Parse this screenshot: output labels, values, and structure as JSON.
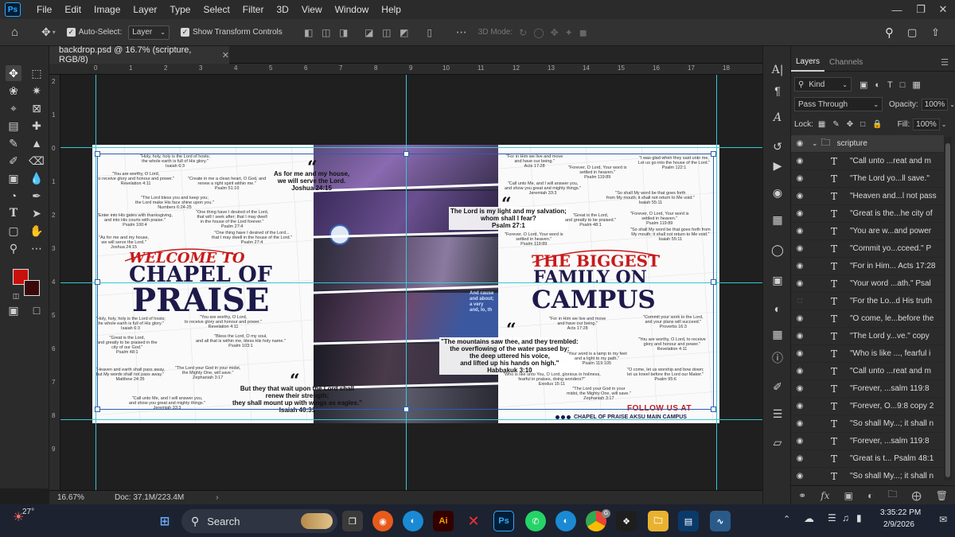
{
  "app": {
    "logo": "Ps",
    "menus": [
      "File",
      "Edit",
      "Image",
      "Layer",
      "Type",
      "Select",
      "Filter",
      "3D",
      "View",
      "Window",
      "Help"
    ]
  },
  "options": {
    "auto_select_label": "Auto-Select:",
    "auto_select_target": "Layer",
    "transform_controls_label": "Show Transform Controls",
    "mode_3d_label": "3D Mode:"
  },
  "document": {
    "tab_title": "backdrop.psd @ 16.7% (scripture, RGB/8)",
    "ruler_top": [
      "0",
      "1",
      "2",
      "3",
      "4",
      "5",
      "6",
      "7",
      "8",
      "9",
      "10",
      "11",
      "12",
      "13",
      "14",
      "15",
      "16",
      "17",
      "18"
    ],
    "ruler_left": [
      "2",
      "1",
      "0",
      "1",
      "2",
      "3",
      "4",
      "5",
      "6",
      "7",
      "8",
      "9"
    ]
  },
  "artwork": {
    "left_title_script": "WELCOME TO",
    "left_title_line1": "CHAPEL OF",
    "left_title_line2": "PRAISE",
    "right_title_line1": "THE BIGGEST",
    "right_title_line2": "FAMILY ON",
    "right_title_line3": "CAMPUS",
    "follow_us": "FOLLOW US AT",
    "handle": "CHAPEL OF PRAISE AKSU MAIN CAMPUS",
    "quote_joshua": "As for me and my house,\nwe will serve the Lord.\nJoshua 24:15",
    "quote_psalm27": "The Lord is my light and my salvation;\nwhom shall I fear?\nPsalm 27:1",
    "quote_habakkuk": "\"The mountains saw thee, and they trembled:\nthe overflowing of the water passed by:\nthe deep uttered his voice,\nand lifted up his hands on high.\"\nHabbakuk 3:10",
    "quote_isaiah": "But they that wait upon the Lord shall\nrenew their strength;\nthey shall mount up with wings as eagles.\"\nIsaiah 40:31",
    "small_verses_left": [
      "\"Holy, holy, holy is the Lord of hosts;\nthe whole earth is full of His glory.\"\nIsaiah 6:3",
      "\"You are worthy, O Lord,\nto receive glory and honour and power.\"\nRevelation 4:11",
      "\"Create in me a clean heart, O God, and\nrenew a right spirit within me.\"\nPsalm 51:10",
      "\"The Lord bless you and keep you;\nthe Lord make His face shine upon you.\"\nNumbers 6:24-25",
      "\"Enter into His gates with thanksgiving,\nand into His courts with praise.\"\nPsalm 100:4",
      "\"One thing have I desired of the Lord,\nthat will I seek after; that I may dwell\nin the house of the Lord forever.\"\nPsalm 27:4",
      "\"As for me and my house,\nwe will serve the Lord.\"\nJoshua 24:15",
      "\"One thing have I desired of the Lord...\nthat I may dwell in the house of the Lord.\"\nPsalm 27:4",
      "\"Holy, holy, holy is the Lord of hosts;\nthe whole earth is full of His glory.\"\nIsaiah 6:3",
      "\"You are worthy, O Lord,\nto receive glory and honour and power.\"\nRevelation 4:11",
      "\"Great is the Lord,\nand greatly to be praised in the\ncity of our God.\"\nPsalm 48:1",
      "\"Bless the Lord, O my soul,\nand all that is within me, bless His holy name.\"\nPsalm 103:1",
      "\"Heaven and earth shall pass away,\nbut My words shall not pass away.\"\nMatthew 24:35",
      "\"The Lord your God in your midst,\nthe Mighty One, will save.\"\nZephaniah 3:17",
      "\"Call unto Me, and I will answer you,\nand show you great and mighty things.\"\nJeremiah 33:3"
    ],
    "small_verses_right": [
      "\"For in Him we live and move\nand have our being.\"\nActs 17:28",
      "\"Forever, O Lord, Your word is\nsettled in heaven.\"\nPsalm 119:89",
      "\"I was glad when they said unto me,\nLet us go into the house of the Lord.\"\nPsalm 122:1",
      "\"Call unto Me, and I will answer you,\nand show you great and mighty things.\"\nJeremiah 33:3",
      "\"So shall My word be that goes forth\nfrom My mouth; it shall not return to Me void.\"\nIsaiah 55:11",
      "\"Great is the Lord,\nand greatly to be praised.\"\nPsalm 48:1",
      "\"Forever, O Lord, Your word is\nsettled in heaven.\"\nPsalm 119:89",
      "\"Forever, O Lord, Your word is\nsettled in heaven.\"\nPsalm 119:89",
      "\"So shall My word be that goes forth from\nMy mouth; it shall not return to Me void.\"\nIsaiah 55:11",
      "\"For in Him we live and move\nand have our being.\"\nActs 17:28",
      "\"Commit your work to the Lord,\nand your plans will succeed.\"\nProverbs 16:3",
      "\"You are worthy, O Lord, to receive\nglory and honour and power.\"\nRevelation 4:11",
      "\"Your word is a lamp to my feet\nand a light to my path.\"\nPsalm 119:105",
      "\"O come, let us worship and bow down;\nlet us kneel before the Lord our Maker.\"\nPsalm 95:6",
      "\"Who is like unto You, O Lord, glorious in holiness,\nfearful in praises, doing wonders?\"\nExodus 15:11",
      "\"The Lord your God in your\nmidst, the Mighty One, will save.\"\nZephaniah 3:17"
    ],
    "photo_overlay_text": "And cause\nand about;\na very\nand, lo, th"
  },
  "status": {
    "zoom": "16.67%",
    "doc_size": "Doc: 37.1M/223.4M"
  },
  "layers_panel": {
    "tabs": [
      "Layers",
      "Channels"
    ],
    "filter_kind": "Kind",
    "blend_mode": "Pass Through",
    "opacity_label": "Opacity:",
    "opacity_value": "100%",
    "lock_label": "Lock:",
    "fill_label": "Fill:",
    "fill_value": "100%",
    "group_name": "scripture",
    "layers": [
      {
        "name": "\"Call unto ...reat and m",
        "visible": true
      },
      {
        "name": "\"The Lord yo...ll save.\"",
        "visible": true
      },
      {
        "name": "\"Heaven and...l not pass",
        "visible": true
      },
      {
        "name": "\"Great is the...he  city of",
        "visible": true
      },
      {
        "name": "\"You are w...and power",
        "visible": true
      },
      {
        "name": "\"Commit yo...cceed.\" P",
        "visible": true
      },
      {
        "name": "\"For in Him... Acts 17:28",
        "visible": true
      },
      {
        "name": "\"Your word ...ath.\" Psal",
        "visible": true
      },
      {
        "name": "\"For the Lo...d His truth",
        "visible": false
      },
      {
        "name": "\"O come, le...before the",
        "visible": true
      },
      {
        "name": "\"The Lord y...ve.\" copy",
        "visible": true
      },
      {
        "name": "\"Who is like ...,  fearful i",
        "visible": true
      },
      {
        "name": "\"Call unto ...reat and m",
        "visible": true
      },
      {
        "name": "\"Forever, ...salm 119:8",
        "visible": true
      },
      {
        "name": "\"Forever, O...9:8 copy 2",
        "visible": true
      },
      {
        "name": "\"So shall My...; it shall n",
        "visible": true
      },
      {
        "name": "\"Forever, ...salm 119:8",
        "visible": true
      },
      {
        "name": "\"Great is t... Psalm 48:1",
        "visible": true
      },
      {
        "name": "\"So shall My...; it shall n",
        "visible": true
      }
    ]
  },
  "taskbar": {
    "temperature": "27°",
    "search_label": "Search",
    "time": "3:35:22 PM",
    "date": "2/9/2026",
    "chrome_badge": "G"
  },
  "colors": {
    "accent_ps": "#31a8ff",
    "foreground_swatch": "#c8100c",
    "background_swatch": "#3a0a0a",
    "guide": "#39c5d6",
    "title_navy": "#1d1a4a",
    "title_red": "#c81a1a"
  }
}
